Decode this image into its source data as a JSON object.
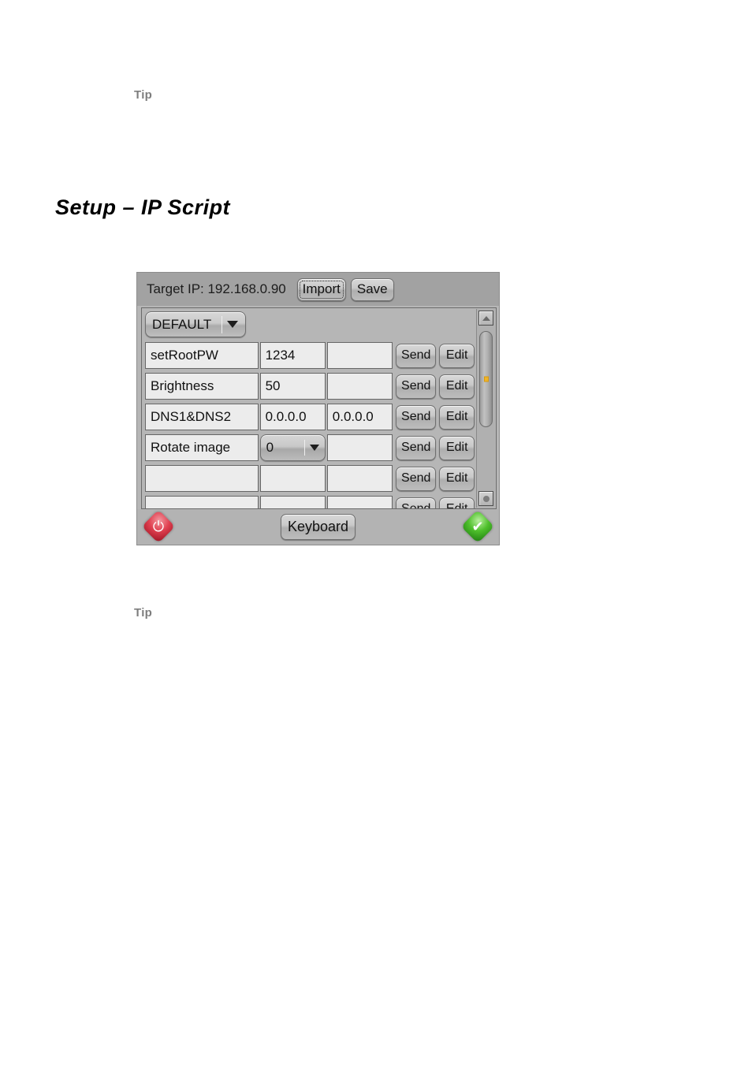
{
  "document": {
    "tip_top_label": "Tip",
    "heading": "Setup – IP Script",
    "tip_bottom_label": "Tip"
  },
  "device": {
    "header": {
      "target_ip_label": "Target IP: 192.168.0.90",
      "import_button": "Import",
      "save_button": "Save"
    },
    "profile_select": {
      "selected": "DEFAULT",
      "caret_icon": "chevron-down-icon"
    },
    "columns": [
      "name",
      "value1",
      "value2",
      "send",
      "edit"
    ],
    "row_actions": {
      "send_label": "Send",
      "edit_label": "Edit"
    },
    "rows": [
      {
        "name": "setRootPW",
        "value1": "1234",
        "value2": "",
        "value1_type": "text",
        "send": "Send",
        "edit": "Edit"
      },
      {
        "name": "Brightness",
        "value1": "50",
        "value2": "",
        "value1_type": "text",
        "send": "Send",
        "edit": "Edit"
      },
      {
        "name": "DNS1&DNS2",
        "value1": "0.0.0.0",
        "value2": "0.0.0.0",
        "value1_type": "text",
        "send": "Send",
        "edit": "Edit"
      },
      {
        "name": "Rotate image",
        "value1": "0",
        "value2": "",
        "value1_type": "select",
        "send": "Send",
        "edit": "Edit"
      },
      {
        "name": "",
        "value1": "",
        "value2": "",
        "value1_type": "text",
        "send": "Send",
        "edit": "Edit"
      },
      {
        "name": "",
        "value1": "",
        "value2": "",
        "value1_type": "text",
        "send": "Send",
        "edit": "Edit"
      }
    ],
    "scrollbar": {
      "up_icon": "triangle-up-icon",
      "down_icon": "circle-icon",
      "thumb_marker_color": "#f0b428"
    },
    "footer": {
      "keyboard_button": "Keyboard",
      "power_icon": "power-reset-icon",
      "confirm_icon": "check-icon",
      "power_glyph": "⏻",
      "confirm_glyph": "✔"
    }
  },
  "colors": {
    "panel_background": "#b6b6b6",
    "header_background": "#a2a2a2",
    "cell_background": "#ececec",
    "accent_marker": "#f0b428",
    "power_red": "#e04050",
    "confirm_green": "#4fc02c"
  }
}
